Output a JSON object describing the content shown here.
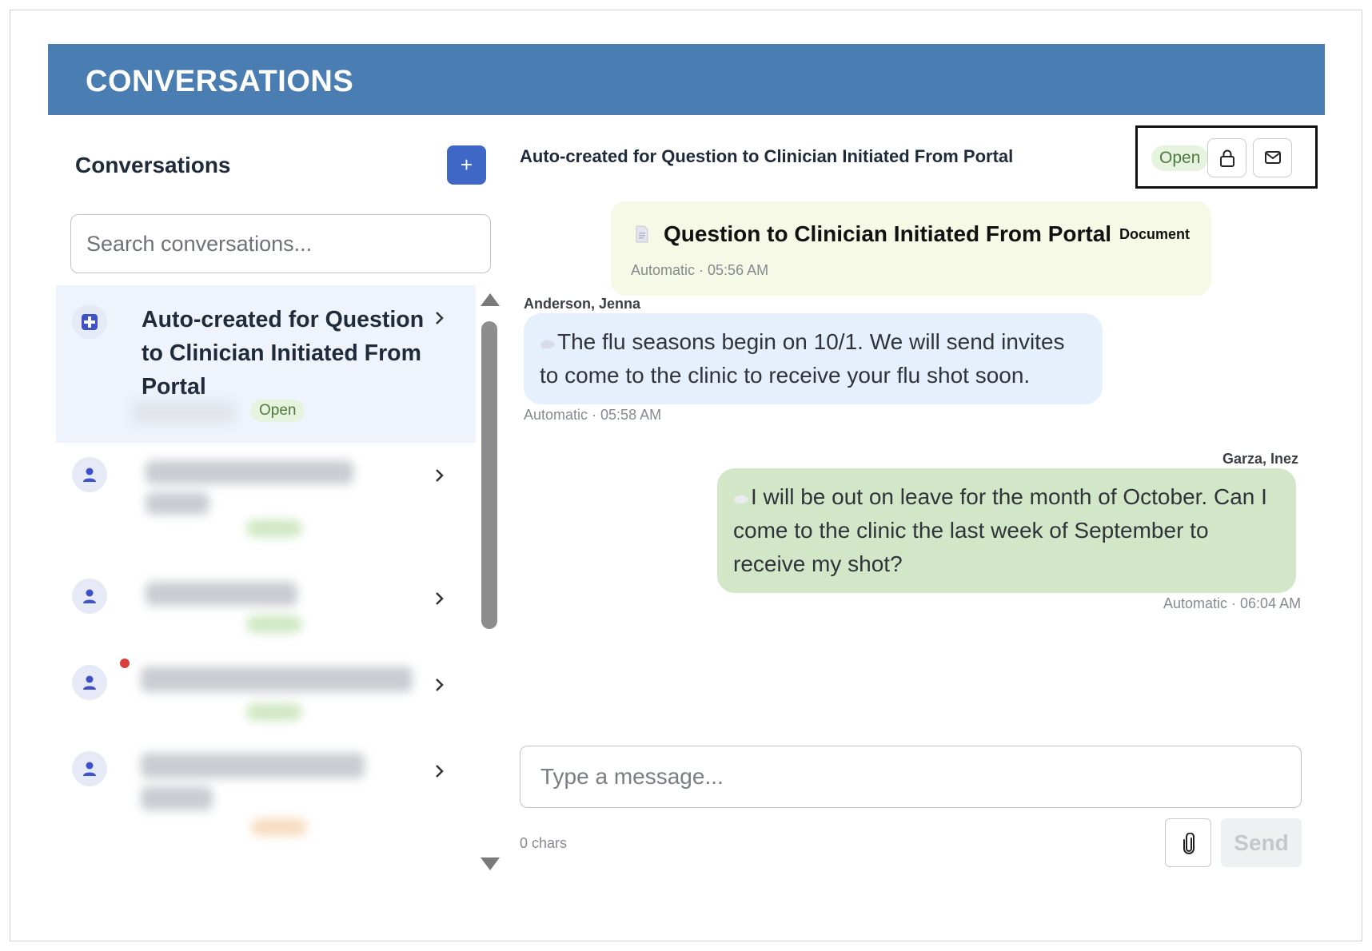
{
  "banner": {
    "title": "CONVERSATIONS"
  },
  "sidebar": {
    "title": "Conversations",
    "add_label": "+",
    "search_placeholder": "Search conversations...",
    "items": [
      {
        "title": "Auto-created for Question to Clinician Initiated From Portal",
        "status": "Open",
        "icon": "plus-square-icon",
        "active": true
      },
      {
        "title": "",
        "status": "",
        "icon": "person-icon",
        "blurred": true,
        "status_color": "#cfe8c3"
      },
      {
        "title": "",
        "status": "",
        "icon": "person-icon",
        "blurred": true,
        "status_color": "#cfe8c3"
      },
      {
        "title": "",
        "status": "",
        "icon": "person-icon",
        "blurred": true,
        "unread": true,
        "status_color": "#cfe8c3"
      },
      {
        "title": "",
        "status": "",
        "icon": "person-icon",
        "blurred": true,
        "status_color": "#f7dcc0"
      }
    ]
  },
  "conversation": {
    "title": "Auto-created for Question to Clinician Initiated From Portal",
    "status": "Open",
    "actions": [
      "lock-icon",
      "mail-icon"
    ],
    "document": {
      "title": "Question to Clinician Initiated From Portal",
      "tag": "Document",
      "meta": "Automatic · 05:56 AM"
    },
    "messages": [
      {
        "sender": "Anderson, Jenna",
        "text": "The flu seasons begin on 10/1. We will send invites to come to the clinic to receive your flu shot soon.",
        "meta": "Automatic · 05:58 AM",
        "direction": "incoming"
      },
      {
        "sender": "Garza, Inez",
        "text": "I will be out on leave for the month of October. Can I come to the clinic the last week of September to receive my shot?",
        "meta": "Automatic · 06:04 AM",
        "direction": "outgoing"
      }
    ],
    "composer": {
      "placeholder": "Type a message...",
      "char_count": "0 chars",
      "send_label": "Send"
    }
  },
  "colors": {
    "banner": "#4a7db1",
    "primary_button": "#3f68c6",
    "incoming_bubble": "#e6f0fc",
    "outgoing_bubble": "#d2e6c8",
    "document_card": "#f6f9e6",
    "open_badge": "#e6f3df"
  }
}
